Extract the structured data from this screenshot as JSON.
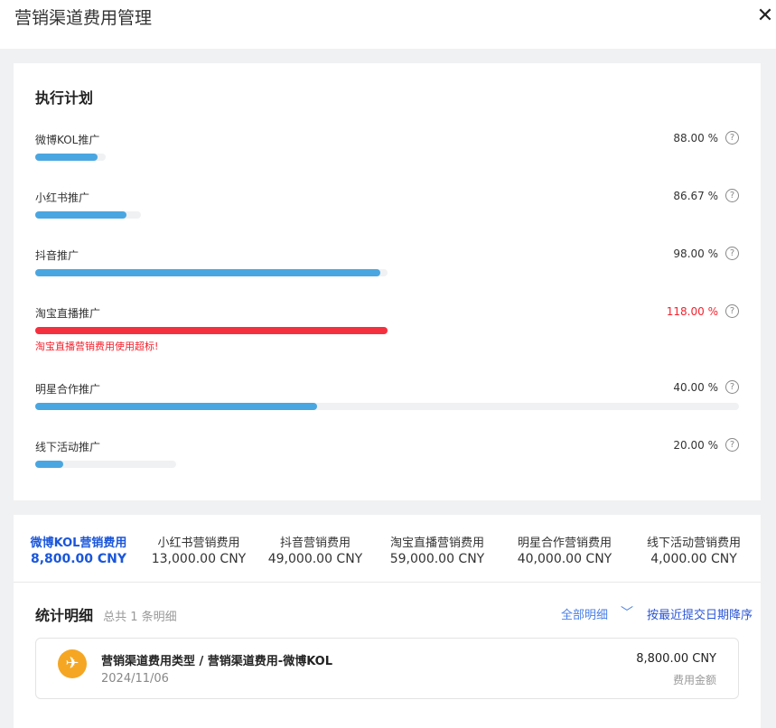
{
  "window": {
    "title": "营销渠道费用管理",
    "close_symbol": "✕"
  },
  "plan": {
    "heading": "执行计划",
    "help_symbol": "?",
    "rows": [
      {
        "label": "微博KOL推广",
        "percent_text": "88.00 %",
        "percent": 88,
        "track_fraction": 0.1,
        "over": false
      },
      {
        "label": "小红书推广",
        "percent_text": "86.67 %",
        "percent": 86.67,
        "track_fraction": 0.15,
        "over": false
      },
      {
        "label": "抖音推广",
        "percent_text": "98.00 %",
        "percent": 98,
        "track_fraction": 0.5,
        "over": false
      },
      {
        "label": "淘宝直播推广",
        "percent_text": "118.00 %",
        "percent": 118,
        "track_fraction": 0.5,
        "over": true,
        "warning": "淘宝直播营销费用使用超标!"
      },
      {
        "label": "明星合作推广",
        "percent_text": "40.00 %",
        "percent": 40,
        "track_fraction": 1.0,
        "over": false
      },
      {
        "label": "线下活动推广",
        "percent_text": "20.00 %",
        "percent": 20,
        "track_fraction": 0.2,
        "over": false
      }
    ]
  },
  "tabs": [
    {
      "name": "微博KOL营销费用",
      "amount": "8,800.00 CNY",
      "active": true
    },
    {
      "name": "小红书营销费用",
      "amount": "13,000.00 CNY",
      "active": false
    },
    {
      "name": "抖音营销费用",
      "amount": "49,000.00 CNY",
      "active": false
    },
    {
      "name": "淘宝直播营销费用",
      "amount": "59,000.00 CNY",
      "active": false
    },
    {
      "name": "明星合作营销费用",
      "amount": "40,000.00 CNY",
      "active": false
    },
    {
      "name": "线下活动营销费用",
      "amount": "4,000.00 CNY",
      "active": false
    }
  ],
  "stats": {
    "title": "统计明细",
    "count_text": "总共 1 条明细",
    "filter_label": "全部明细",
    "filter_symbol": "﹀",
    "sort_label": "按最近提交日期降序"
  },
  "records": [
    {
      "icon": "airplane-icon",
      "icon_symbol": "✈",
      "name": "营销渠道费用类型 / 营销渠道费用-微博KOL",
      "date": "2024/11/06",
      "amount": "8,800.00 CNY",
      "amount_label": "费用金额"
    }
  ],
  "colors": {
    "bar": "#4aa6e0",
    "bar_over": "#f5303e",
    "accent": "#1a56db",
    "icon_bg": "#f5a623"
  }
}
